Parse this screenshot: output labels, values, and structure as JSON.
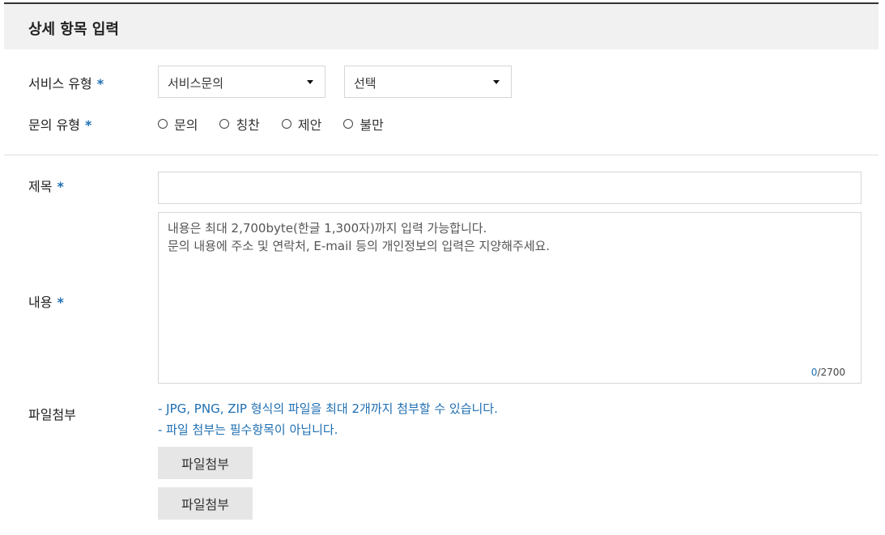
{
  "section": {
    "title": "상세 항목 입력"
  },
  "required_mark": "*",
  "service_type": {
    "label": "서비스 유형",
    "select1_value": "서비스문의",
    "select2_value": "선택"
  },
  "inquiry_type": {
    "label": "문의 유형",
    "options": [
      "문의",
      "칭찬",
      "제안",
      "불만"
    ]
  },
  "subject": {
    "label": "제목",
    "value": ""
  },
  "content": {
    "label": "내용",
    "placeholder": "내용은 최대 2,700byte(한글 1,300자)까지 입력 가능합니다.\n문의 내용에 주소 및 연락처, E-mail 등의 개인정보의 입력은 지양해주세요.",
    "count_current": "0",
    "count_max": "/2700"
  },
  "attachment": {
    "label": "파일첨부",
    "notes": [
      "- JPG, PNG, ZIP 형식의 파일을 최대 2개까지 첨부할 수 있습니다.",
      "- 파일 첨부는 필수항목이 아닙니다."
    ],
    "buttons": [
      "파일첨부",
      "파일첨부"
    ]
  },
  "colors": {
    "accent": "#1f6fb2",
    "header_bg": "#f1f1f1",
    "button_bg": "#e6e6e6"
  }
}
